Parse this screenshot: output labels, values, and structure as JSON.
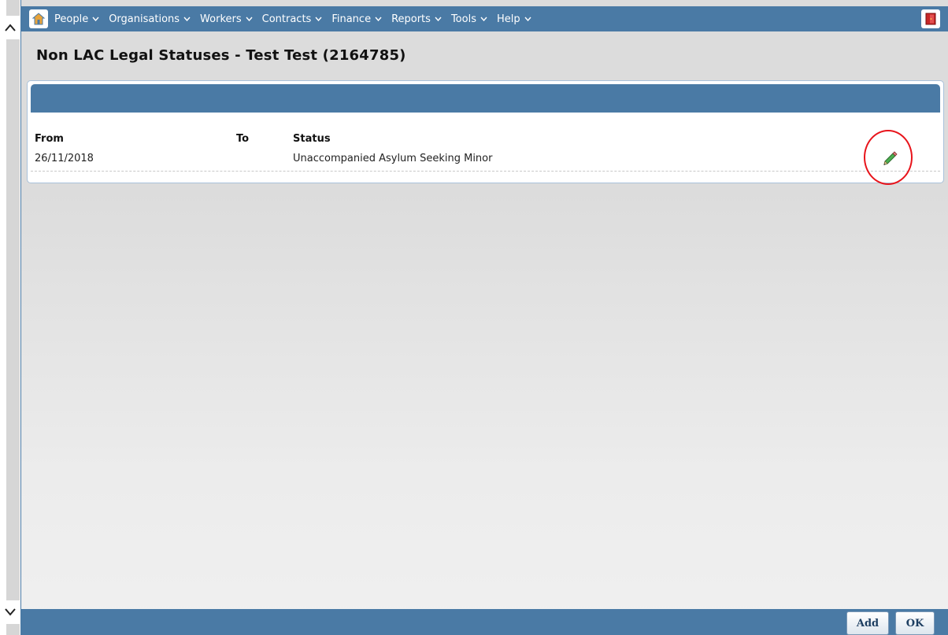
{
  "menu": {
    "items": [
      {
        "label": "People"
      },
      {
        "label": "Organisations"
      },
      {
        "label": "Workers"
      },
      {
        "label": "Contracts"
      },
      {
        "label": "Finance"
      },
      {
        "label": "Reports"
      },
      {
        "label": "Tools"
      },
      {
        "label": "Help"
      }
    ],
    "home_icon": "home-icon",
    "exit_icon": "exit-door-icon"
  },
  "page": {
    "title": "Non LAC Legal Statuses - Test Test (2164785)"
  },
  "table": {
    "headers": {
      "from": "From",
      "to": "To",
      "status": "Status"
    },
    "rows": [
      {
        "from": "26/11/2018",
        "to": "",
        "status": "Unaccompanied Asylum Seeking Minor",
        "action_icon": "pencil-edit-icon"
      }
    ]
  },
  "footer": {
    "add_label": "Add",
    "ok_label": "OK"
  },
  "colors": {
    "bar": "#4a7aa5",
    "highlight": "#e8141b"
  }
}
